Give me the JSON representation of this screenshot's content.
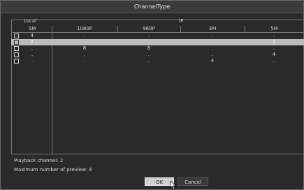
{
  "title": "ChannelType",
  "groups": {
    "local": "Local",
    "ip": "IP"
  },
  "columns": [
    "5M",
    "1080P",
    "960P",
    "3M",
    "5M"
  ],
  "rows": [
    {
      "selected": false,
      "values": [
        "4",
        ".",
        ".",
        ".",
        "."
      ]
    },
    {
      "selected": true,
      "values": [
        "2",
        ".",
        ".",
        ".",
        "2"
      ]
    },
    {
      "selected": false,
      "values": [
        ".",
        "8",
        "8",
        ".",
        "."
      ]
    },
    {
      "selected": false,
      "values": [
        ".",
        ".",
        ".",
        ".",
        "4"
      ]
    },
    {
      "selected": false,
      "values": [
        ".",
        ".",
        ".",
        "4",
        "."
      ]
    }
  ],
  "info": {
    "playback": "Playback channel: 2",
    "max_preview": "Maximum number of preview: 4"
  },
  "buttons": {
    "ok": "OK",
    "cancel": "Cancel"
  }
}
